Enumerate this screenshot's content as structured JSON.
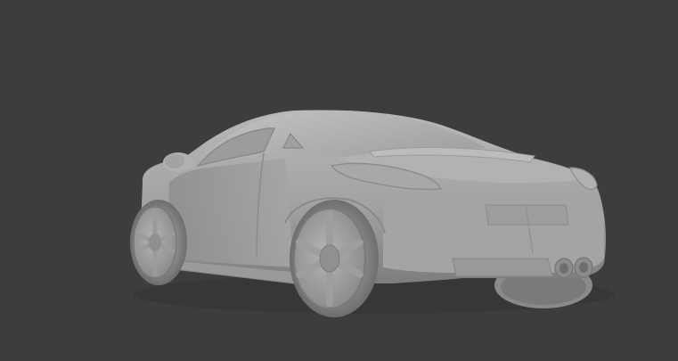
{
  "viewport": {
    "background_color": "#3d3d3d",
    "shading_mode": "solid",
    "model_color": "#a9a9a9"
  },
  "model": {
    "object": "sports-car-mesh"
  }
}
